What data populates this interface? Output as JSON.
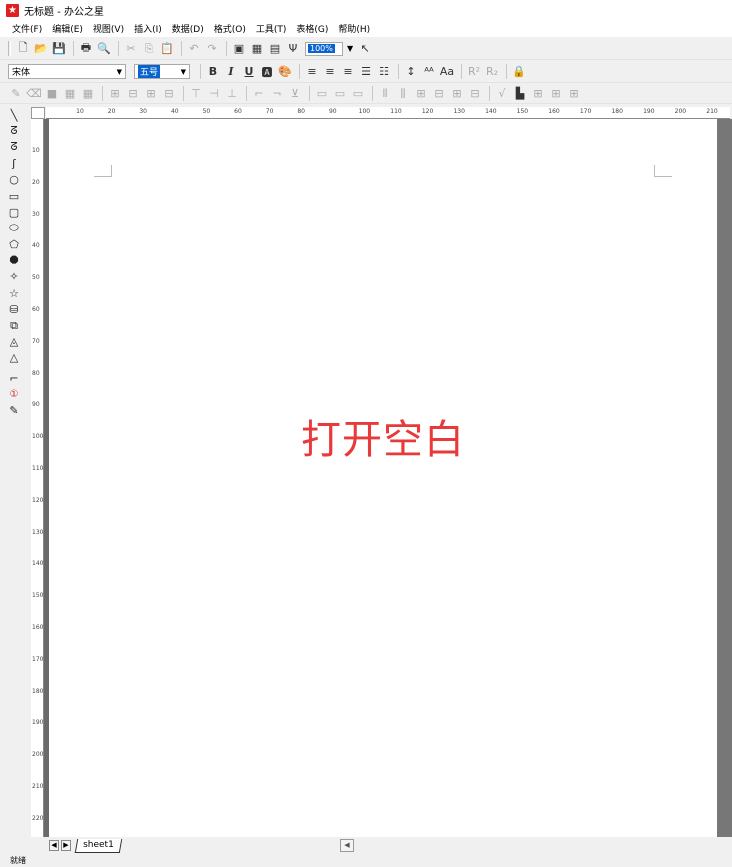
{
  "window": {
    "title": "无标题 - 办公之星",
    "app_icon": "star-icon"
  },
  "menu": [
    "文件(F)",
    "编辑(E)",
    "视图(V)",
    "插入(I)",
    "数据(D)",
    "格式(O)",
    "工具(T)",
    "表格(G)",
    "帮助(H)"
  ],
  "toolbar": {
    "zoom": "100%"
  },
  "format": {
    "font_name": "宋体",
    "font_size": "五号",
    "bold": "B",
    "italic": "I",
    "underline": "U"
  },
  "hruler_ticks": [
    "10",
    "20",
    "30",
    "40",
    "50",
    "60",
    "70",
    "80",
    "90",
    "100",
    "110",
    "120",
    "130",
    "140",
    "150",
    "160",
    "170",
    "180",
    "190",
    "200",
    "210"
  ],
  "vruler_ticks": [
    "10",
    "20",
    "30",
    "40",
    "50",
    "60",
    "70",
    "80",
    "90",
    "100",
    "110",
    "120",
    "130",
    "140",
    "150",
    "160",
    "170",
    "180",
    "190",
    "200",
    "210",
    "220"
  ],
  "canvas": {
    "caption": "打开空白"
  },
  "sheets": [
    "sheet1"
  ],
  "status": "就绪"
}
